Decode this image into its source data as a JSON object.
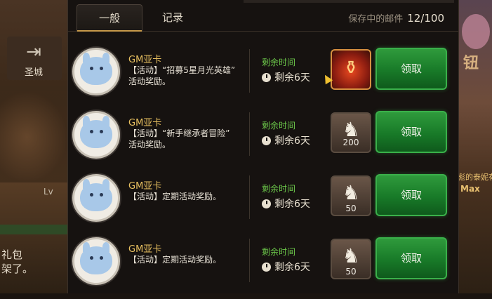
{
  "background": {
    "left_location_label": "圣城",
    "left_level_text": "Lv",
    "left_gift_line1": "礼包",
    "left_gift_line2": "架了。",
    "right_sign_text": "钮",
    "right_text1": "彪的泰妮有",
    "right_text2": "Max"
  },
  "tabs": [
    {
      "label": "一般",
      "active": true
    },
    {
      "label": "记录",
      "active": false
    }
  ],
  "mail_box": {
    "label": "保存中的邮件",
    "count": "12/100"
  },
  "mails": [
    {
      "sender": "GM亚卡",
      "line1": "【活动】“招募5星月光英雄”",
      "line2": "活动奖励。",
      "remaining_label": "剩余时间",
      "remaining_time": "剩余6天",
      "reward_icon": "potion-icon",
      "reward_qty": "",
      "claim_label": "领取"
    },
    {
      "sender": "GM亚卡",
      "line1": "【活动】“新手继承者冒险”",
      "line2": "活动奖励。",
      "remaining_label": "剩余时间",
      "remaining_time": "剩余6天",
      "reward_icon": "horse-icon",
      "reward_qty": "200",
      "claim_label": "领取"
    },
    {
      "sender": "GM亚卡",
      "line1": "【活动】定期活动奖励。",
      "line2": "",
      "remaining_label": "剩余时间",
      "remaining_time": "剩余6天",
      "reward_icon": "horse-icon",
      "reward_qty": "50",
      "claim_label": "领取"
    },
    {
      "sender": "GM亚卡",
      "line1": "【活动】定期活动奖励。",
      "line2": "",
      "remaining_label": "剩余时间",
      "remaining_time": "剩余6天",
      "reward_icon": "horse-icon",
      "reward_qty": "50",
      "claim_label": "领取"
    }
  ],
  "colors": {
    "accent_gold": "#c79a4a",
    "sender_gold": "#e8c060",
    "remaining_green": "#6cc84a",
    "claim_green": "#187a28"
  }
}
